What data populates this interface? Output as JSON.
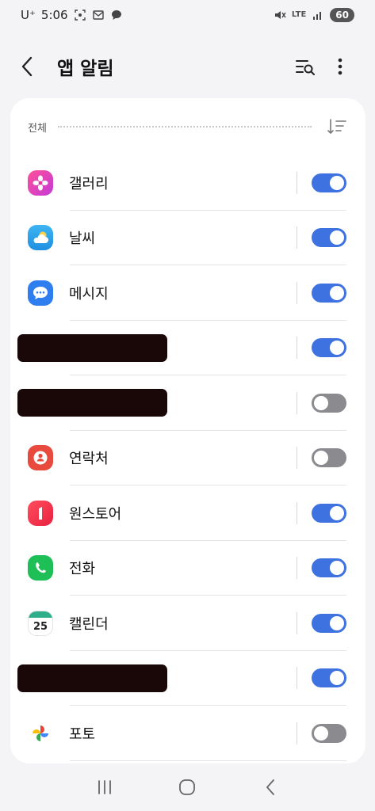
{
  "status_bar": {
    "carrier": "U⁺",
    "time": "5:06",
    "network": "LTE",
    "battery": "60"
  },
  "header": {
    "title": "앱 알림"
  },
  "section": {
    "label": "전체"
  },
  "apps": [
    {
      "name": "갤러리",
      "enabled": true,
      "icon": "gallery-icon"
    },
    {
      "name": "날씨",
      "enabled": true,
      "icon": "weather-icon"
    },
    {
      "name": "메시지",
      "enabled": true,
      "icon": "messages-icon"
    },
    {
      "name": "",
      "enabled": true,
      "icon": "redacted"
    },
    {
      "name": "",
      "enabled": false,
      "icon": "redacted"
    },
    {
      "name": "연락처",
      "enabled": false,
      "icon": "contacts-icon"
    },
    {
      "name": "원스토어",
      "enabled": true,
      "icon": "onestore-icon"
    },
    {
      "name": "전화",
      "enabled": true,
      "icon": "phone-icon"
    },
    {
      "name": "캘린더",
      "enabled": true,
      "icon": "calendar-icon",
      "day": "25"
    },
    {
      "name": "",
      "enabled": true,
      "icon": "redacted"
    },
    {
      "name": "포토",
      "enabled": false,
      "icon": "photos-icon"
    }
  ],
  "colors": {
    "toggle_on": "#3d72e0",
    "toggle_off": "#8a8a8f",
    "background": "#f4f4f6",
    "card": "#ffffff"
  }
}
